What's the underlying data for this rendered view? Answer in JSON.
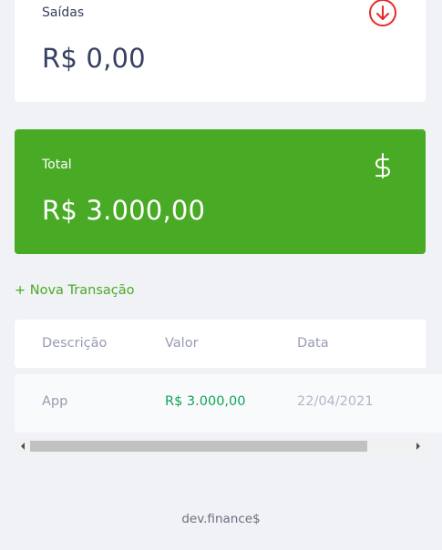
{
  "cards": {
    "outflow": {
      "label": "Saídas",
      "value": "R$ 0,00",
      "icon": "arrow-down-circle-icon",
      "icon_color": "#e92929"
    },
    "total": {
      "label": "Total",
      "value": "R$ 3.000,00",
      "icon": "dollar-sign-icon",
      "background": "#49aa26"
    }
  },
  "actions": {
    "new_transaction": "+ Nova Transação"
  },
  "table": {
    "headers": [
      "Descrição",
      "Valor",
      "Data"
    ],
    "rows": [
      {
        "description": "App",
        "amount": "R$ 3.000,00",
        "date": "22/04/2021"
      }
    ],
    "amount_color": "#12a454"
  },
  "footer": {
    "text": "dev.finance$"
  }
}
